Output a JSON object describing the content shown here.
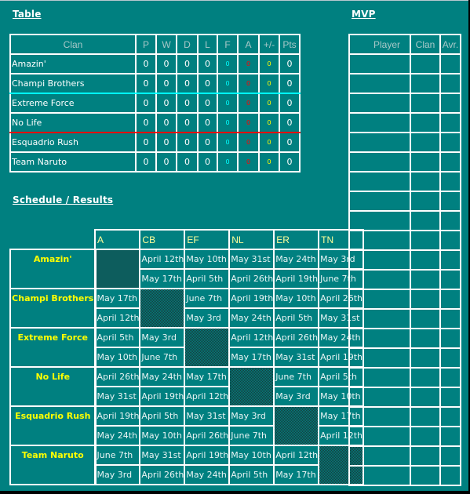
{
  "standings": {
    "title": "Table",
    "headers": [
      "Clan",
      "P",
      "W",
      "D",
      "L",
      "F",
      "A",
      "+/-",
      "Pts"
    ],
    "rows": [
      {
        "clan": "Amazin'",
        "P": "0",
        "W": "0",
        "D": "0",
        "L": "0",
        "F": "0",
        "A": "0",
        "GD": "0",
        "Pts": "0"
      },
      {
        "clan": "Champi Brothers",
        "P": "0",
        "W": "0",
        "D": "0",
        "L": "0",
        "F": "0",
        "A": "0",
        "GD": "0",
        "Pts": "0"
      },
      {
        "clan": "Extreme Force",
        "P": "0",
        "W": "0",
        "D": "0",
        "L": "0",
        "F": "0",
        "A": "0",
        "GD": "0",
        "Pts": "0"
      },
      {
        "clan": "No Life",
        "P": "0",
        "W": "0",
        "D": "0",
        "L": "0",
        "F": "0",
        "A": "0",
        "GD": "0",
        "Pts": "0"
      },
      {
        "clan": "Esquadrio Rush",
        "P": "0",
        "W": "0",
        "D": "0",
        "L": "0",
        "F": "0",
        "A": "0",
        "GD": "0",
        "Pts": "0"
      },
      {
        "clan": "Team Naruto",
        "P": "0",
        "W": "0",
        "D": "0",
        "L": "0",
        "F": "0",
        "A": "0",
        "GD": "0",
        "Pts": "0"
      }
    ],
    "colors": {
      "for": "#00ffff",
      "against": "#ff0000",
      "diff": "#ffff00",
      "promotion_line": "#00ffff",
      "relegation_line": "#ff0000"
    }
  },
  "schedule": {
    "title": "Schedule / Results",
    "columns": [
      "A",
      "CB",
      "EF",
      "NL",
      "ER",
      "TN"
    ],
    "teams": [
      {
        "name": "Amazin'",
        "first": [
          "",
          "April 12th",
          "May 10th",
          "May 31st",
          "May 24th",
          "May 3rd"
        ],
        "second": [
          "",
          "May 17th",
          "April 5th",
          "April 26th",
          "April 19th",
          "June 7th"
        ]
      },
      {
        "name": "Champi Brothers",
        "first": [
          "May 17th",
          "",
          "June 7th",
          "April 19th",
          "May 10th",
          "April 26th"
        ],
        "second": [
          "April 12th",
          "",
          "May 3rd",
          "May 24th",
          "April 5th",
          "May 31st"
        ]
      },
      {
        "name": "Extreme Force",
        "first": [
          "April 5th",
          "May 3rd",
          "",
          "April 12th",
          "April 26th",
          "May 24th"
        ],
        "second": [
          "May 10th",
          "June 7th",
          "",
          "May 17th",
          "May 31st",
          "April 19th"
        ]
      },
      {
        "name": "No Life",
        "first": [
          "April 26th",
          "May 24th",
          "May 17th",
          "",
          "June 7th",
          "April 5th"
        ],
        "second": [
          "May 31st",
          "April 19th",
          "April 12th",
          "",
          "May 3rd",
          "May 10th"
        ]
      },
      {
        "name": "Esquadrio Rush",
        "first": [
          "April 19th",
          "April 5th",
          "May 31st",
          "May 3rd",
          "",
          "May 17th"
        ],
        "second": [
          "May 24th",
          "May 10th",
          "April 26th",
          "June 7th",
          "",
          "April 12th"
        ]
      },
      {
        "name": "Team Naruto",
        "first": [
          "June 7th",
          "May 31st",
          "April 19th",
          "May 10th",
          "April 12th",
          ""
        ],
        "second": [
          "May 3rd",
          "April 26th",
          "May 24th",
          "April 5th",
          "May 17th",
          ""
        ]
      }
    ]
  },
  "mvp": {
    "title": "MVP",
    "headers": [
      "Player",
      "Clan",
      "Avr."
    ],
    "empty_rows": 22
  }
}
